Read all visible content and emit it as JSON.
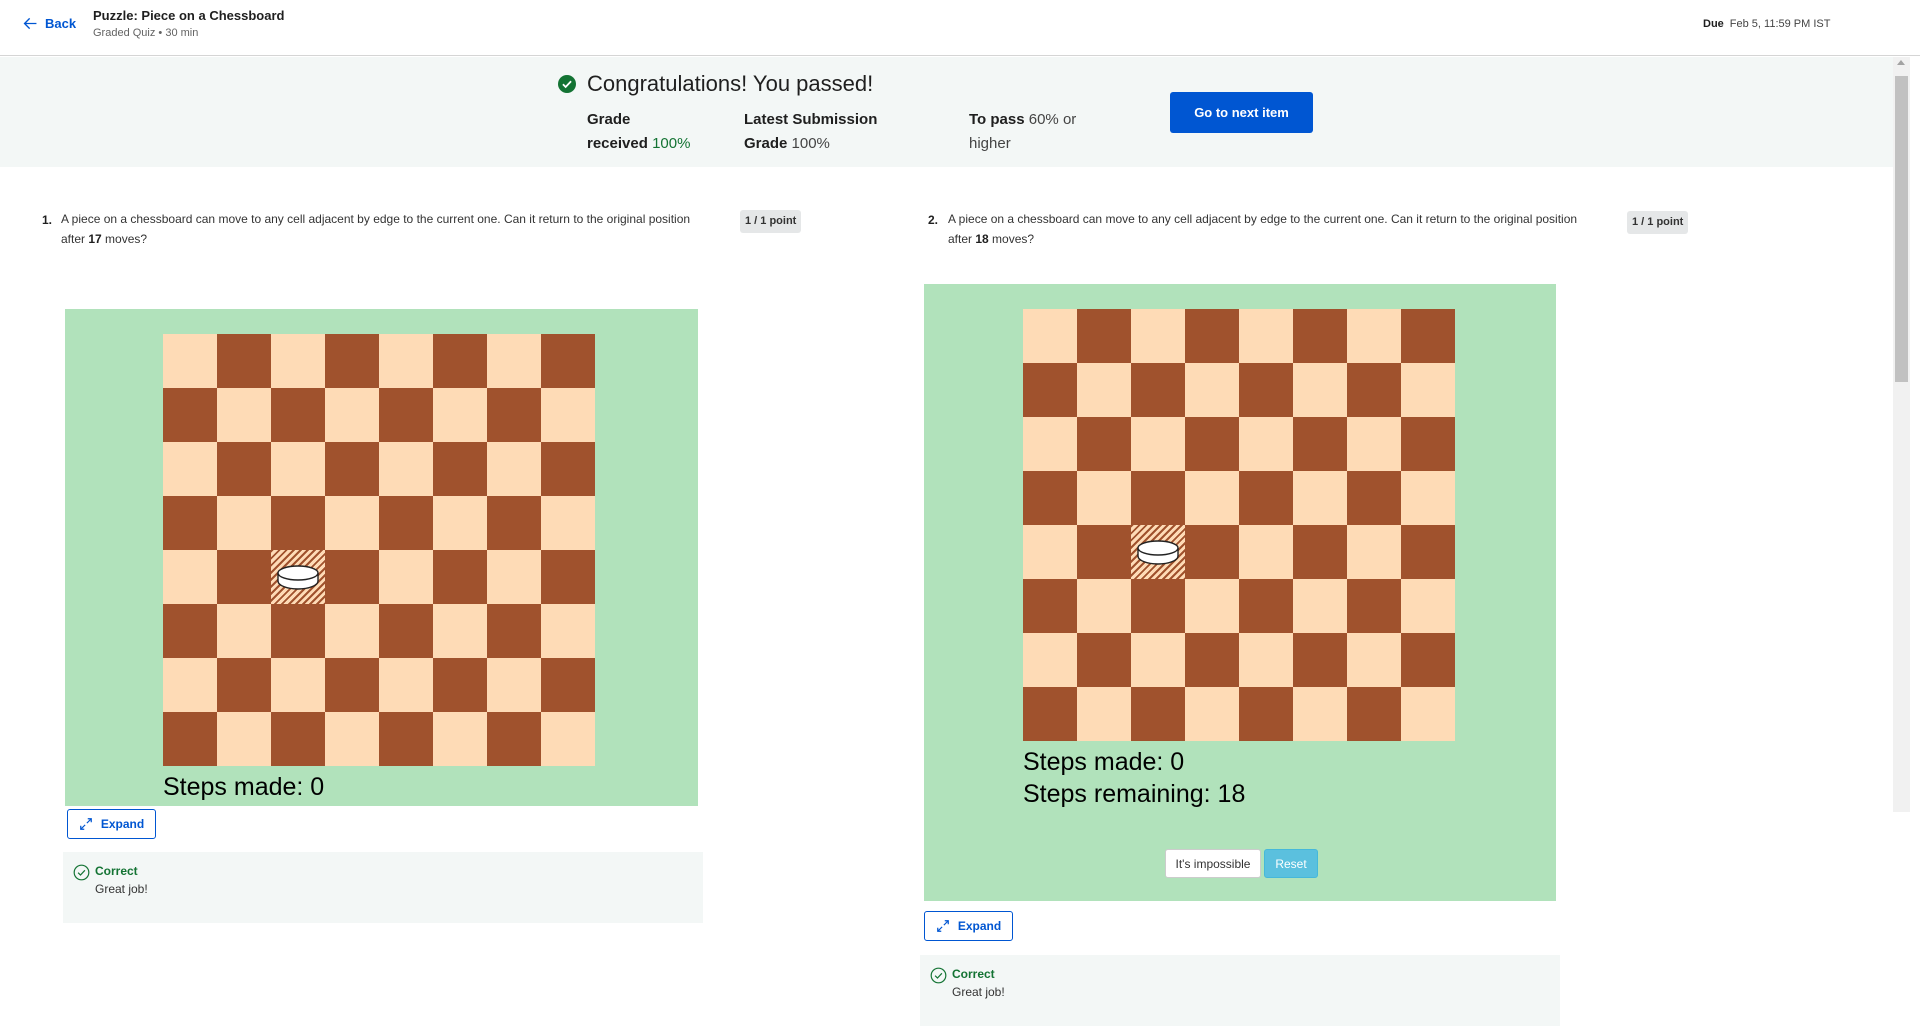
{
  "header": {
    "back_label": "Back",
    "title": "Puzzle: Piece on a Chessboard",
    "subtitle": "Graded Quiz • 30 min",
    "due_label": "Due",
    "due_value": "Feb 5, 11:59 PM IST"
  },
  "banner": {
    "headline": "Congratulations! You passed!",
    "grade_received_label_1": "Grade",
    "grade_received_label_2": "received",
    "grade_received_value": "100%",
    "latest_label_1": "Latest Submission",
    "latest_label_2": "Grade",
    "latest_value": "100%",
    "to_pass_label": "To pass",
    "to_pass_value_1": "60% or",
    "to_pass_value_2": "higher",
    "next_button": "Go to next item"
  },
  "questions": [
    {
      "number": "1.",
      "text_before": "A piece on a chessboard can move to any cell adjacent by edge to the current one. Can it return to the original position after ",
      "moves": "17",
      "text_after": " moves?",
      "points": "1 / 1 point",
      "steps_made": "Steps made: 0",
      "piece_position": {
        "row": 5,
        "col": 3
      },
      "expand_label": "Expand",
      "feedback_label": "Correct",
      "feedback_message": "Great job!"
    },
    {
      "number": "2.",
      "text_before": "A piece on a chessboard can move to any cell adjacent by edge to the current one. Can it return to the original position after ",
      "moves": "18",
      "text_after": " moves?",
      "points": "1 / 1 point",
      "steps_made": "Steps made: 0",
      "steps_remaining": "Steps remaining: 18",
      "piece_position": {
        "row": 5,
        "col": 3
      },
      "impossible_button": "It's impossible",
      "reset_button": "Reset",
      "expand_label": "Expand",
      "feedback_label": "Correct",
      "feedback_message": "Great job!"
    }
  ],
  "colors": {
    "accent": "#0056d2",
    "success": "#137333",
    "board_light": "#fedbb6",
    "board_dark": "#a0522d",
    "widget_bg": "#b1e2bb"
  },
  "icons": {
    "back": "arrow-left-icon",
    "passed": "check-circle-icon",
    "expand": "expand-arrows-icon",
    "correct": "check-circle-outline-icon"
  }
}
